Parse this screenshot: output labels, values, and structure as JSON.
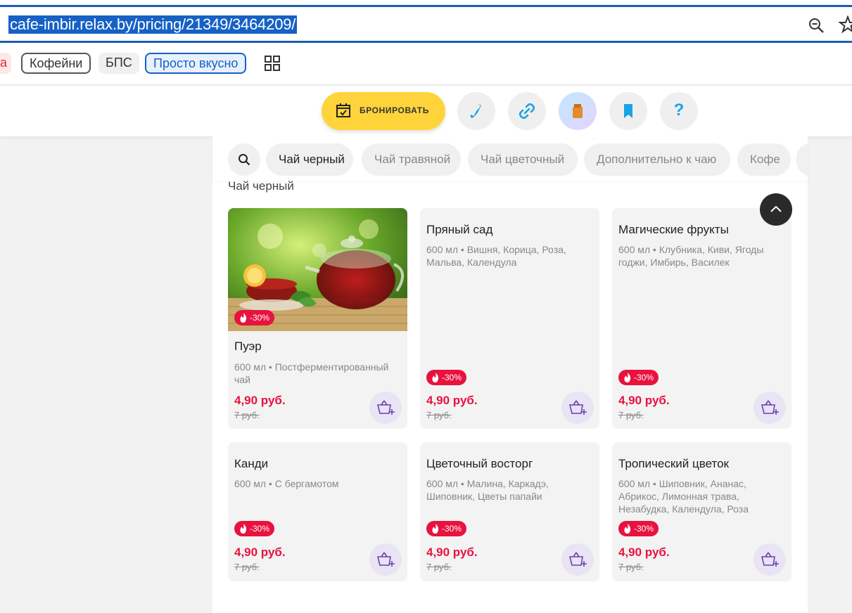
{
  "browser": {
    "url": "cafe-imbir.relax.by/pricing/21349/3464209/"
  },
  "chips": {
    "partial": "а",
    "coffee": "Кофейни",
    "bps": "БПС",
    "tasty": "Просто вкусно"
  },
  "actions": {
    "book_label": "БРОНИРОВАТЬ",
    "help_label": "?"
  },
  "tabs": [
    {
      "label": "Чай черный",
      "active": true
    },
    {
      "label": "Чай травяной",
      "active": false
    },
    {
      "label": "Чай цветочный",
      "active": false
    },
    {
      "label": "Дополнительно к чаю",
      "active": false
    },
    {
      "label": "Кофе",
      "active": false
    }
  ],
  "section_title": "Чай черный",
  "products": [
    {
      "name": "Пуэр",
      "desc": "600 мл • Постферментированный чай",
      "discount": "-30%",
      "price": "4,90 руб.",
      "old_price": "7 руб.",
      "has_photo": true
    },
    {
      "name": "Пряный сад",
      "desc": "600 мл • Вишня, Корица, Роза, Мальва, Календула",
      "discount": "-30%",
      "price": "4,90 руб.",
      "old_price": "7 руб.",
      "has_photo": false
    },
    {
      "name": "Магические фрукты",
      "desc": "600 мл • Клубника, Киви, Ягоды годжи, Имбирь, Василек",
      "discount": "-30%",
      "price": "4,90 руб.",
      "old_price": "7 руб.",
      "has_photo": false
    },
    {
      "name": "Канди",
      "desc": "600 мл • С бергамотом",
      "discount": "-30%",
      "price": "4,90 руб.",
      "old_price": "7 руб.",
      "has_photo": false
    },
    {
      "name": "Цветочный восторг",
      "desc": "600 мл • Малина, Каркадэ, Шиповник, Цветы папайи",
      "discount": "-30%",
      "price": "4,90 руб.",
      "old_price": "7 руб.",
      "has_photo": false
    },
    {
      "name": "Тропический цветок",
      "desc": "600 мл • Шиповник, Ананас, Абрикос, Лимонная трава, Незабудка, Календула, Роза",
      "discount": "-30%",
      "price": "4,90 руб.",
      "old_price": "7 руб.",
      "has_photo": false
    }
  ],
  "colors": {
    "accent_red": "#e8123f",
    "book_yellow": "#ffd43b",
    "icon_blue": "#1aa3e8",
    "url_highlight": "#1661c4"
  },
  "icons": [
    "zoom-icon",
    "star-icon",
    "grid-icon",
    "calendar-check-icon",
    "phone-icon",
    "link-icon",
    "bag-icon",
    "bookmark-icon",
    "search-icon",
    "chevron-up-icon",
    "flame-icon",
    "cart-add-icon"
  ]
}
